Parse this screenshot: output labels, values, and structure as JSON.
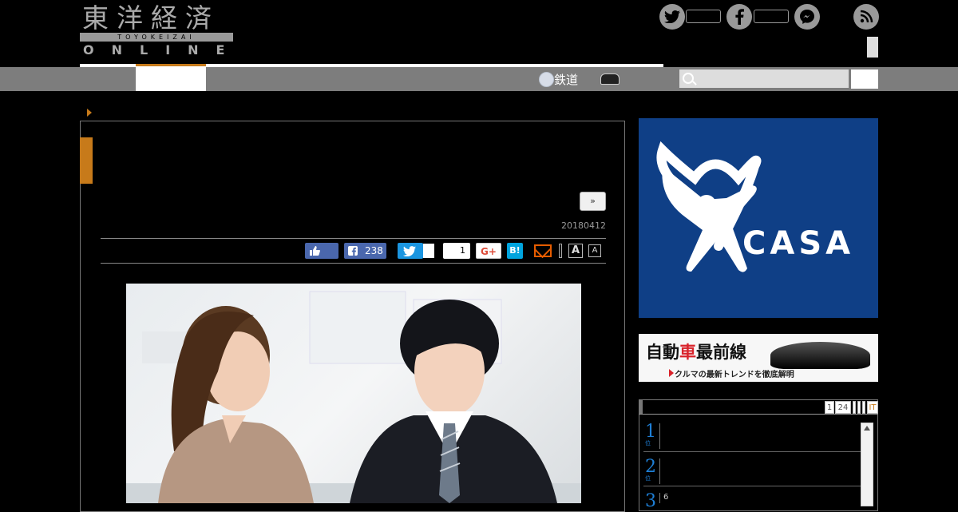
{
  "header": {
    "logo_kanji": "東洋経済",
    "logo_sub": "TOYOKEIZAI",
    "logo_online": "ONLINE"
  },
  "nav": {
    "rail_label": "鉄道",
    "search_placeholder": ""
  },
  "article": {
    "next_label": "»",
    "date": "20180412",
    "share": {
      "facebook_count": "238",
      "hatena_count": "1",
      "gplus_label": "G+",
      "hatena_label": "B!",
      "font_large": "A",
      "font_small": "A"
    }
  },
  "sidebar": {
    "ad_brand": "CASA",
    "ad_mark": "®",
    "banner_title_a": "自動",
    "banner_title_b": "車",
    "banner_title_c": "最前線",
    "banner_sub": "クルマの最新トレンドを徹底解明",
    "ranking": {
      "tabs": [
        "1",
        "24",
        "",
        "",
        "",
        "IT"
      ],
      "items": [
        {
          "num": "1",
          "suffix": "位",
          "text": ""
        },
        {
          "num": "2",
          "suffix": "位",
          "text": ""
        },
        {
          "num": "3",
          "suffix": "",
          "text": "6"
        }
      ]
    }
  },
  "colors": {
    "accent": "#c77a1a",
    "facebook": "#4a67ad",
    "twitter": "#1b95e0",
    "hatena": "#00a4de",
    "ad_bg": "#0f3f86",
    "rank_blue": "#1e7fd6"
  }
}
